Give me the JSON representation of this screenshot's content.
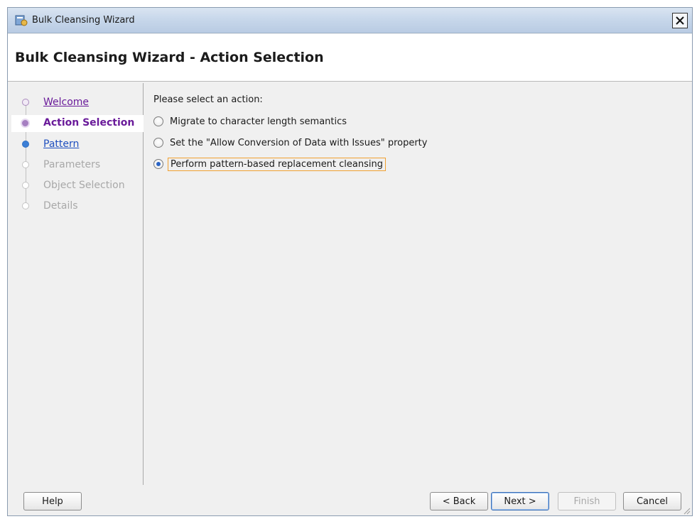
{
  "window": {
    "title": "Bulk Cleansing Wizard",
    "close_symbol": "✕"
  },
  "header": {
    "title": "Bulk Cleansing Wizard - Action Selection"
  },
  "steps": [
    {
      "label": "Welcome",
      "state": "visited"
    },
    {
      "label": "Action Selection",
      "state": "active"
    },
    {
      "label": "Pattern",
      "state": "next"
    },
    {
      "label": "Parameters",
      "state": "disabled"
    },
    {
      "label": "Object Selection",
      "state": "disabled"
    },
    {
      "label": "Details",
      "state": "disabled"
    }
  ],
  "main": {
    "prompt": "Please select an action:",
    "options": [
      {
        "label": "Migrate to character length semantics",
        "mnemonic": "M",
        "checked": false
      },
      {
        "label": "Set the \"Allow Conversion of Data with Issues\" property",
        "mnemonic": "S",
        "checked": false
      },
      {
        "label": "Perform pattern-based replacement cleansing",
        "mnemonic": "P",
        "checked": true
      }
    ]
  },
  "buttons": {
    "help": "Help",
    "back": "< Back",
    "next": "Next >",
    "finish": "Finish",
    "cancel": "Cancel"
  },
  "colors": {
    "visited": "#6a1b9a",
    "link": "#1f4fbf",
    "focus": "#f0a030"
  }
}
